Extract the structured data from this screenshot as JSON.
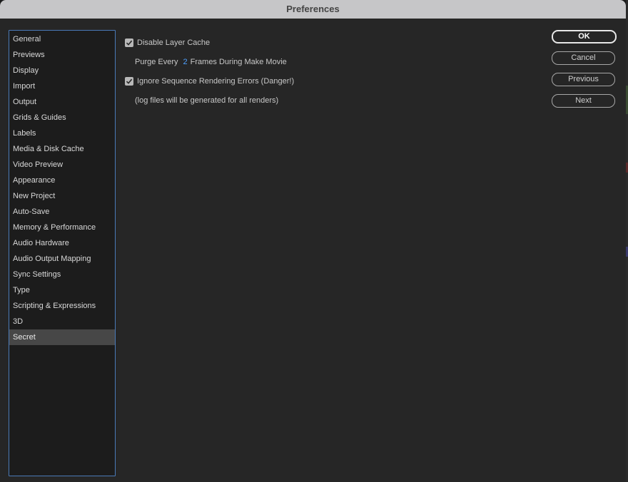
{
  "window": {
    "title": "Preferences"
  },
  "sidebar": {
    "items": [
      {
        "label": "General"
      },
      {
        "label": "Previews"
      },
      {
        "label": "Display"
      },
      {
        "label": "Import"
      },
      {
        "label": "Output"
      },
      {
        "label": "Grids & Guides"
      },
      {
        "label": "Labels"
      },
      {
        "label": "Media & Disk Cache"
      },
      {
        "label": "Video Preview"
      },
      {
        "label": "Appearance"
      },
      {
        "label": "New Project"
      },
      {
        "label": "Auto-Save"
      },
      {
        "label": "Memory & Performance"
      },
      {
        "label": "Audio Hardware"
      },
      {
        "label": "Audio Output Mapping"
      },
      {
        "label": "Sync Settings"
      },
      {
        "label": "Type"
      },
      {
        "label": "Scripting & Expressions"
      },
      {
        "label": "3D"
      },
      {
        "label": "Secret"
      }
    ],
    "selected": "Secret"
  },
  "secret": {
    "disable_layer_cache": {
      "label": "Disable Layer Cache",
      "checked": true
    },
    "purge": {
      "prefix": "Purge Every",
      "value": "2",
      "suffix": "Frames During Make Movie"
    },
    "ignore_errors": {
      "label": "Ignore Sequence Rendering Errors (Danger!)",
      "checked": true
    },
    "log_note": "(log files will be generated for all renders)"
  },
  "buttons": {
    "ok": "OK",
    "cancel": "Cancel",
    "previous": "Previous",
    "next": "Next"
  },
  "colors": {
    "accent": "#4ea1ff",
    "sidebar_border": "#4a7ab8",
    "selected_bg": "#474747",
    "window_bg": "#262626"
  }
}
